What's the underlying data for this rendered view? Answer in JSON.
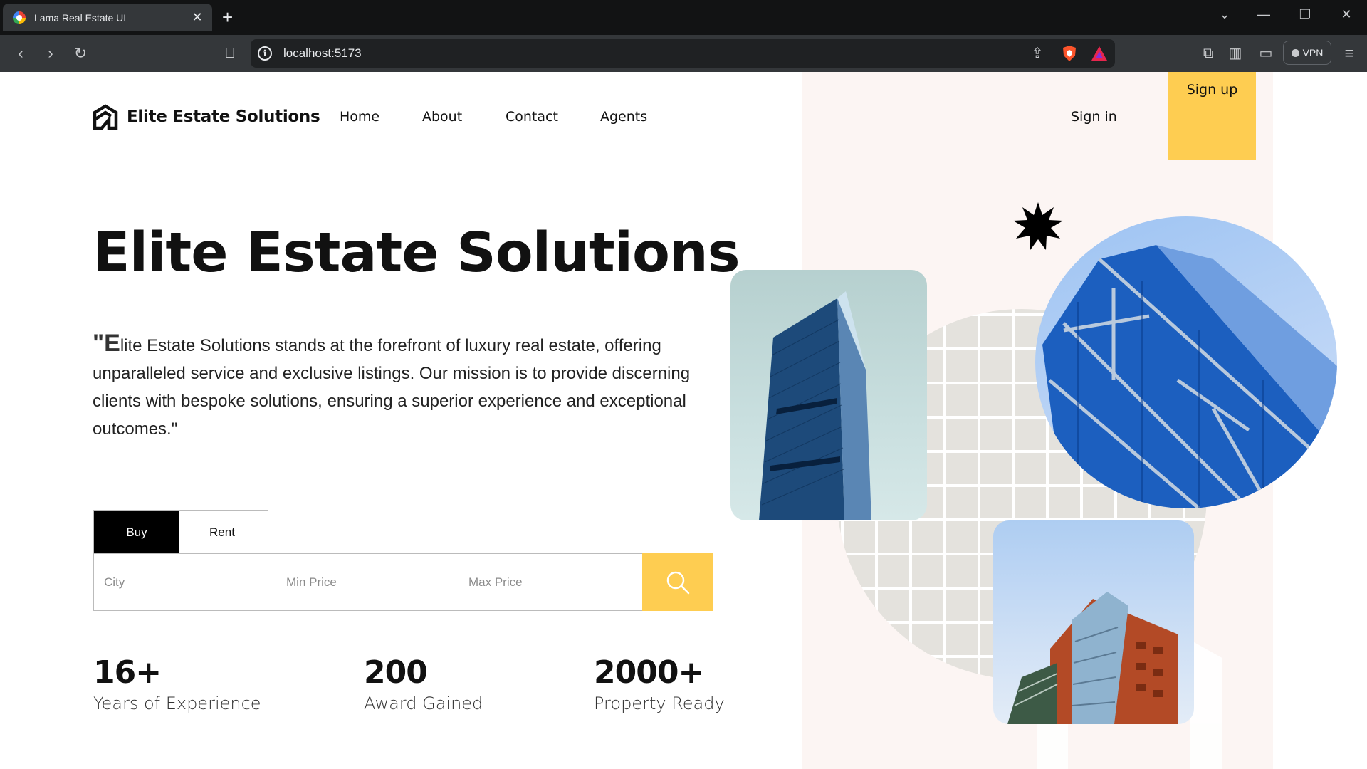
{
  "browser": {
    "tab_title": "Lama Real Estate UI",
    "tab_close": "✕",
    "new_tab": "+",
    "url": "localhost:5173",
    "vpn_label": "VPN"
  },
  "nav": {
    "brand": "Elite Estate Solutions",
    "links": [
      "Home",
      "About",
      "Contact",
      "Agents"
    ],
    "sign_in": "Sign in",
    "sign_up": "Sign up"
  },
  "hero": {
    "title": "Elite Estate Solutions",
    "quote_open": "\"",
    "quote_dropcap": "E",
    "quote_rest": "lite Estate Solutions stands at the forefront of luxury real estate, offering unparalleled service and exclusive listings. Our mission is to provide discerning clients with bespoke solutions, ensuring a superior experience and exceptional outcomes.\""
  },
  "search": {
    "tabs": [
      "Buy",
      "Rent"
    ],
    "active_tab": "Buy",
    "city_placeholder": "City",
    "min_price_placeholder": "Min Price",
    "max_price_placeholder": "Max Price",
    "button_icon": "search-icon"
  },
  "stats": [
    {
      "value": "16+",
      "label": "Years of Experience"
    },
    {
      "value": "200",
      "label": "Award Gained"
    },
    {
      "value": "2000+",
      "label": "Property Ready"
    }
  ],
  "colors": {
    "accent": "#fecd51",
    "right_panel": "#fcf5f3",
    "text": "#111111"
  }
}
